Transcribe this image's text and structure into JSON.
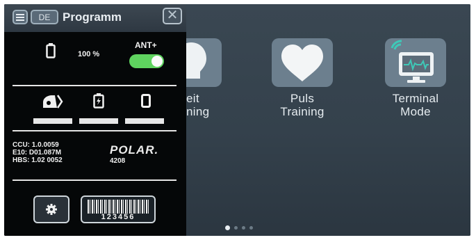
{
  "header": {
    "menu_icon": "hamburger-icon",
    "language": "DE",
    "title": "Programm",
    "close_icon": "close-x-icon"
  },
  "status": {
    "battery_icon": "battery-icon",
    "battery_level": "100 %",
    "ant_label": "ANT+",
    "ant_enabled": true
  },
  "devices": [
    {
      "icon": "bike-device-icon"
    },
    {
      "icon": "battery-charging-icon"
    },
    {
      "icon": "tablet-icon"
    }
  ],
  "versions": {
    "ccu": "CCU: 1.0.0059",
    "e10": "E10: D01.087M",
    "hbs": "HBS: 1.02 0052",
    "brand": "POLAR.",
    "polar_id": "4208"
  },
  "actions": {
    "settings_icon": "gear-icon",
    "barcode_number": "123456"
  },
  "tiles": [
    {
      "line1": "eit",
      "line2": "ning",
      "icon": "lightbulb-icon"
    },
    {
      "line1": "Puls",
      "line2": "Training",
      "icon": "heart-icon"
    },
    {
      "line1": "Terminal",
      "line2": "Mode",
      "icon": "terminal-monitor-icon"
    }
  ],
  "pagination": {
    "pages": 4,
    "current": 1
  },
  "colors": {
    "toggle_on": "#5fd35f",
    "tile": "#6c7f8e",
    "wifi_accent": "#3ec9b8"
  }
}
